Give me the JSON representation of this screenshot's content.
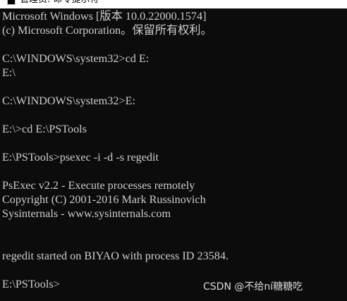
{
  "window": {
    "title": "管理员: 命令提示符",
    "icon": "command-prompt-icon"
  },
  "colors": {
    "background": "#0c0c0c",
    "foreground": "#cccccc",
    "titlebar": "#ffffff"
  },
  "console": {
    "lines": [
      "Microsoft Windows [版本 10.0.22000.1574]",
      "(c) Microsoft Corporation。保留所有权利。",
      "",
      "C:\\WINDOWS\\system32>cd E:",
      "E:\\",
      "",
      "C:\\WINDOWS\\system32>E:",
      "",
      "E:\\>cd E:\\PSTools",
      "",
      "E:\\PSTools>psexec -i -d -s regedit",
      "",
      "PsExec v2.2 - Execute processes remotely",
      "Copyright (C) 2001-2016 Mark Russinovich",
      "Sysinternals - www.sysinternals.com",
      "",
      "",
      "regedit started on BIYAO with process ID 23584.",
      "",
      "E:\\PSTools>"
    ]
  },
  "watermark": {
    "text": "CSDN @不给ní糖糖吃"
  }
}
